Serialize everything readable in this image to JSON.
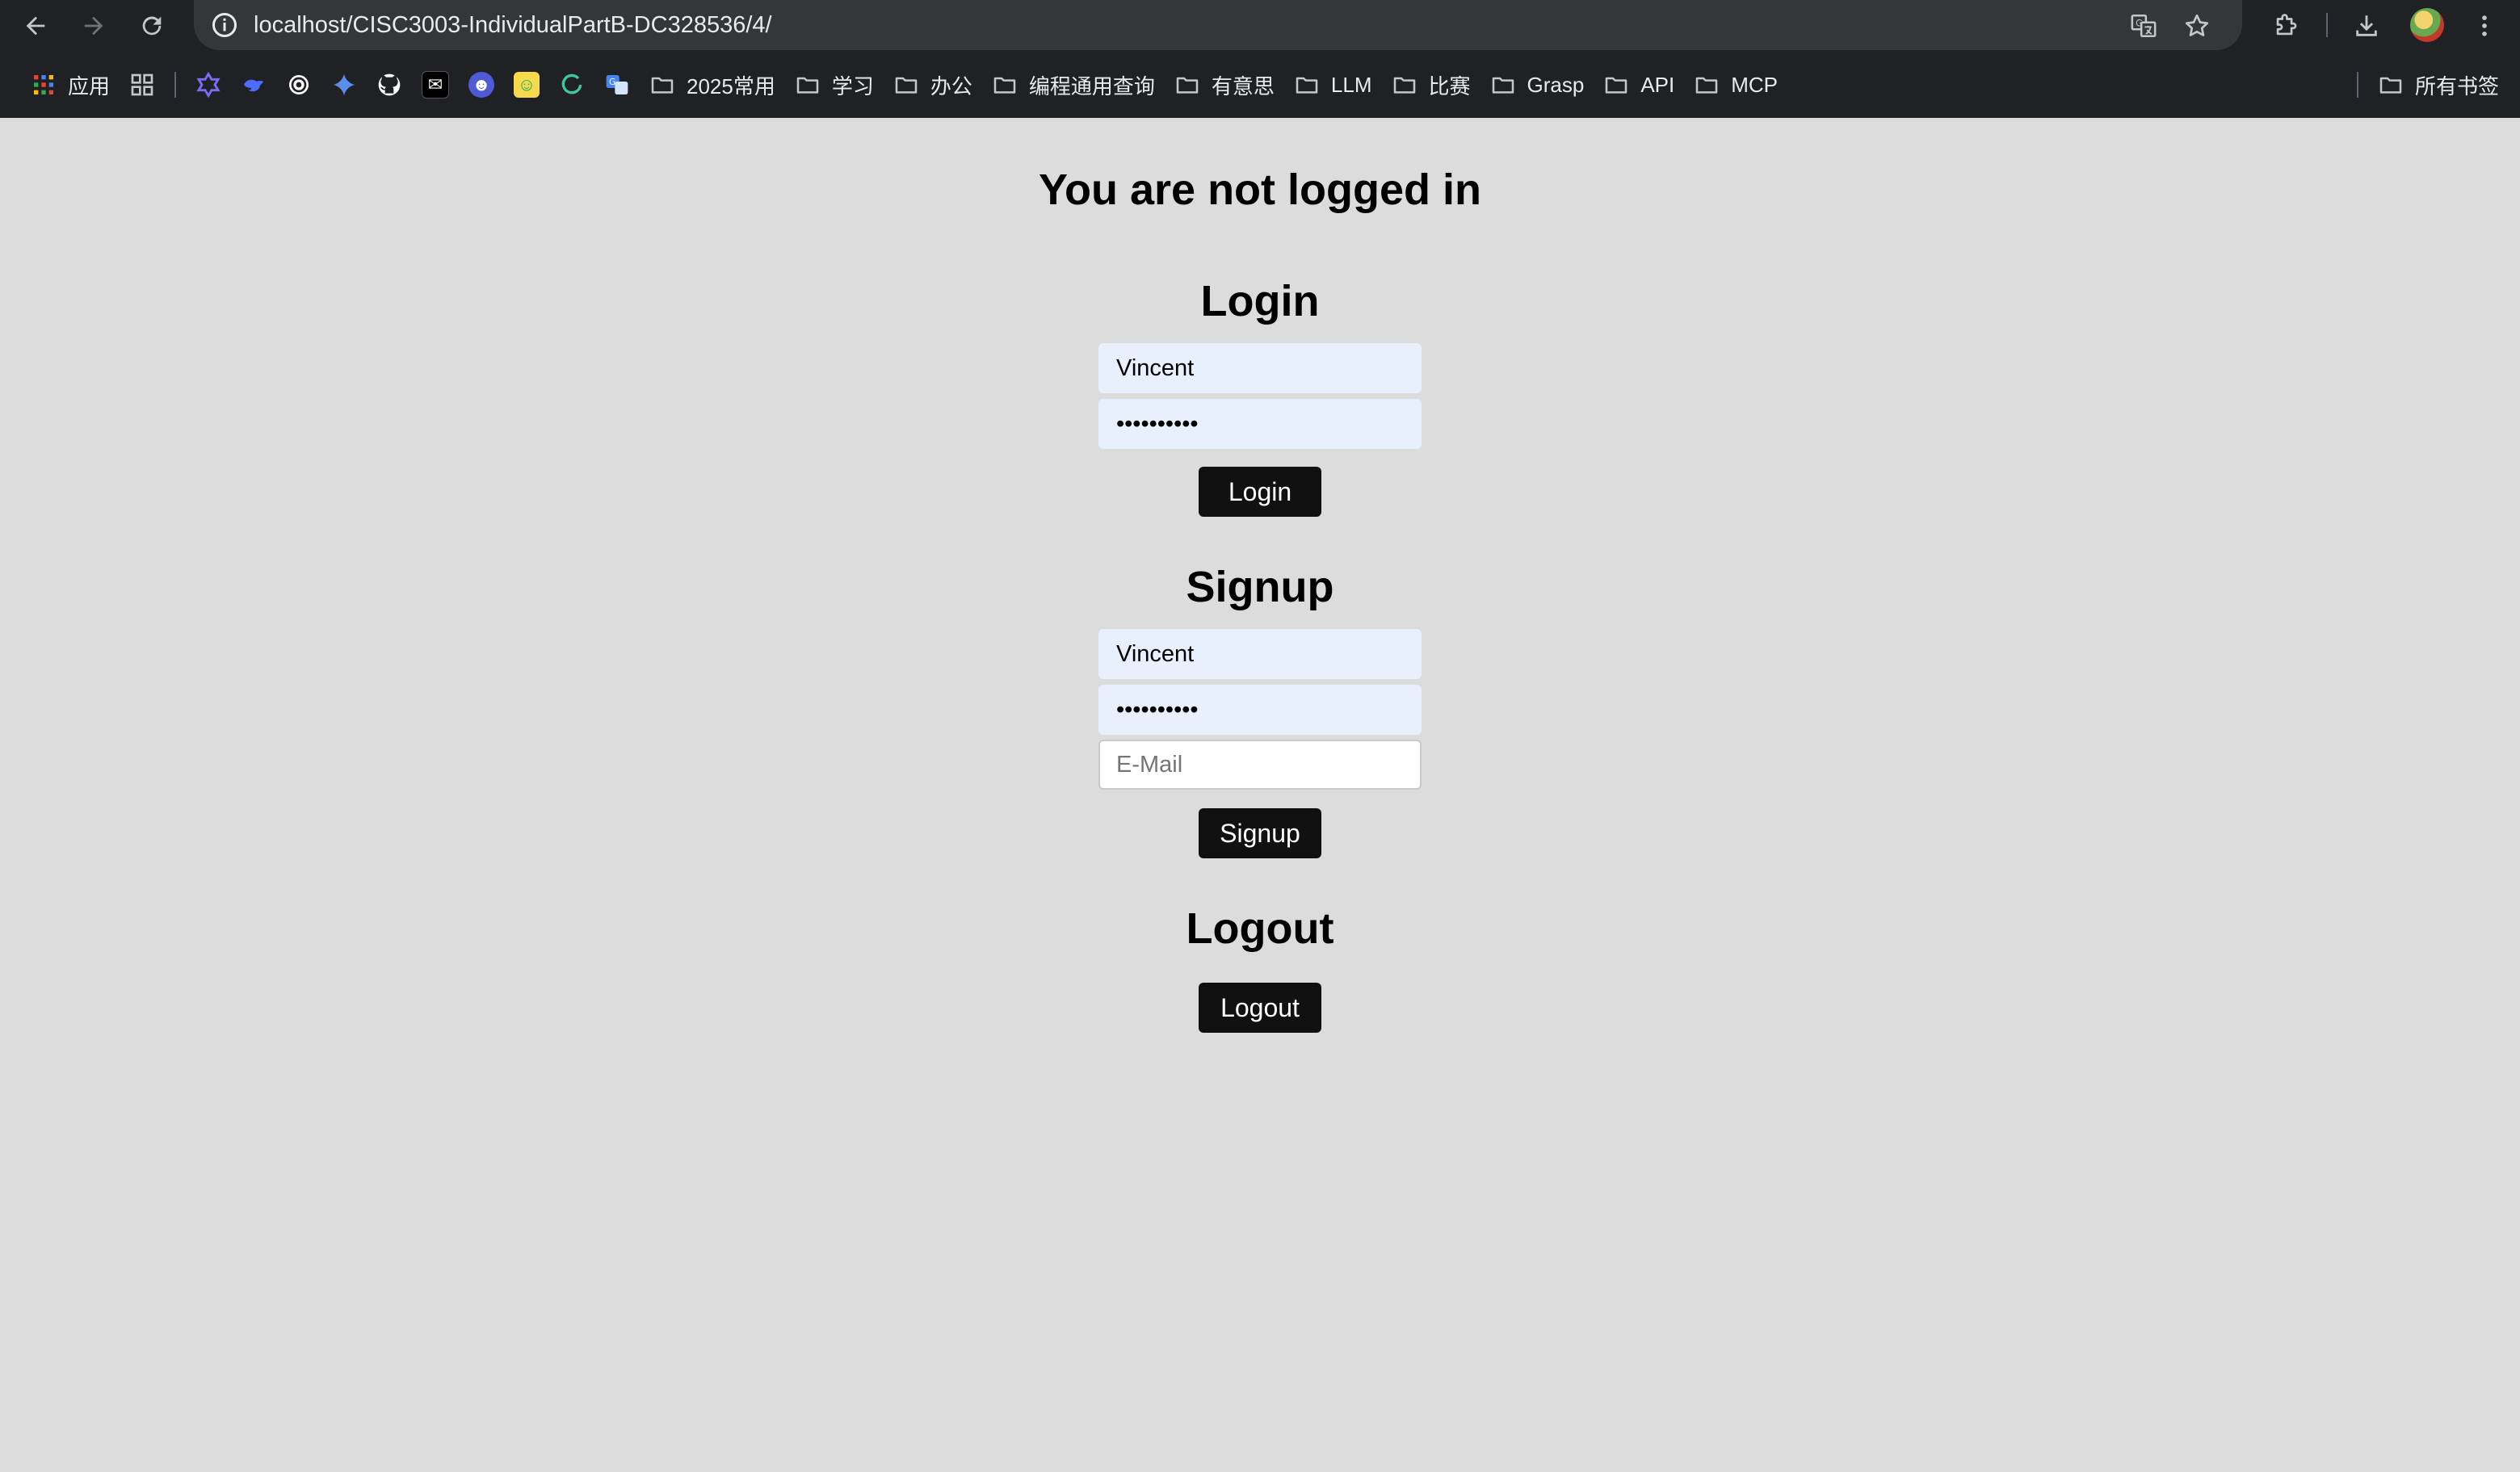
{
  "browser": {
    "url": "localhost/CISC3003-IndividualPartB-DC328536/4/",
    "bookmarks": [
      {
        "label": "应用",
        "icon": "apps-grid-icon"
      },
      {
        "label": "",
        "icon": "tab-groups-icon"
      },
      {
        "label": "",
        "icon": "star-of-david-icon"
      },
      {
        "label": "",
        "icon": "deepseek-icon"
      },
      {
        "label": "",
        "icon": "openai-icon"
      },
      {
        "label": "",
        "icon": "gemini-icon"
      },
      {
        "label": "",
        "icon": "github-icon"
      },
      {
        "label": "",
        "icon": "dark-app-icon"
      },
      {
        "label": "",
        "icon": "blue-app-icon"
      },
      {
        "label": "",
        "icon": "yellow-app-icon"
      },
      {
        "label": "",
        "icon": "refresh-green-icon"
      },
      {
        "label": "",
        "icon": "translate-app-icon"
      },
      {
        "label": "2025常用",
        "icon": "folder-icon"
      },
      {
        "label": "学习",
        "icon": "folder-icon"
      },
      {
        "label": "办公",
        "icon": "folder-icon"
      },
      {
        "label": "编程通用查询",
        "icon": "folder-icon"
      },
      {
        "label": "有意思",
        "icon": "folder-icon"
      },
      {
        "label": "LLM",
        "icon": "folder-icon"
      },
      {
        "label": "比赛",
        "icon": "folder-icon"
      },
      {
        "label": "Grasp",
        "icon": "folder-icon"
      },
      {
        "label": "API",
        "icon": "folder-icon"
      },
      {
        "label": "MCP",
        "icon": "folder-icon"
      }
    ],
    "all_bookmarks": "所有书签"
  },
  "page": {
    "title": "You are not logged in",
    "login": {
      "heading": "Login",
      "username_value": "Vincent",
      "password_value": "••••••••••",
      "button": "Login"
    },
    "signup": {
      "heading": "Signup",
      "username_value": "Vincent",
      "password_value": "••••••••••",
      "email_placeholder": "E-Mail",
      "button": "Signup"
    },
    "logout": {
      "heading": "Logout",
      "button": "Logout"
    }
  }
}
